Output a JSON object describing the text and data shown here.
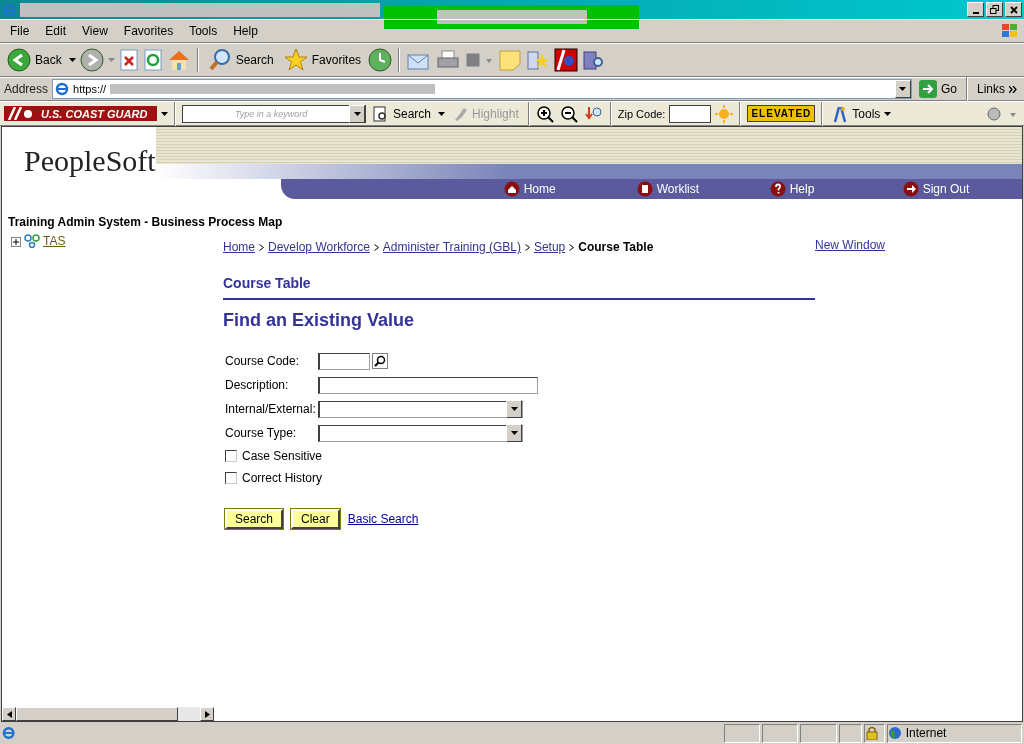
{
  "menu": [
    {
      "label": "File"
    },
    {
      "label": "Edit"
    },
    {
      "label": "View"
    },
    {
      "label": "Favorites"
    },
    {
      "label": "Tools"
    },
    {
      "label": "Help"
    }
  ],
  "toolbar": {
    "back": "Back",
    "search": "Search",
    "favorites": "Favorites"
  },
  "address": {
    "label": "Address",
    "value": "https://",
    "go": "Go",
    "links": "Links"
  },
  "custom_toolbar": {
    "brand": "U.S. COAST GUARD",
    "keyword_placeholder": "Type in a keyword",
    "search": "Search",
    "highlight": {
      "label": "Highlight",
      "disabled": true
    },
    "zip_label": "Zip Code:",
    "threat_level": "ELEVATED",
    "tools": "Tools"
  },
  "header": {
    "logo": "PeopleSoft",
    "nav": [
      {
        "label": "Home",
        "kind": "home"
      },
      {
        "label": "Worklist",
        "kind": "worklist"
      },
      {
        "label": "Help",
        "kind": "help"
      },
      {
        "label": "Sign Out",
        "kind": "signout"
      }
    ]
  },
  "sidebar": {
    "title": "Training Admin System - Business Process Map",
    "tree": [
      {
        "label": "TAS",
        "expanded": false
      }
    ]
  },
  "breadcrumb": [
    {
      "label": "Home",
      "link": true
    },
    {
      "label": "Develop Workforce",
      "link": true
    },
    {
      "label": "Administer Training (GBL)",
      "link": true
    },
    {
      "label": "Setup",
      "link": true
    },
    {
      "label": "Course Table",
      "link": false
    }
  ],
  "new_window": "New Window",
  "section_title": "Course Table",
  "heading": "Find an Existing Value",
  "fields": [
    {
      "label": "Course Code:",
      "kind": "lookup"
    },
    {
      "label": "Description:",
      "kind": "text"
    },
    {
      "label": "Internal/External:",
      "kind": "select"
    },
    {
      "label": "Course Type:",
      "kind": "select"
    }
  ],
  "checkboxes": [
    {
      "label": "Case Sensitive",
      "checked": false
    },
    {
      "label": "Correct History",
      "checked": false
    }
  ],
  "buttons": [
    "Search",
    "Clear"
  ],
  "basic_search": "Basic Search",
  "status_bar": {
    "zone": "Internet"
  }
}
